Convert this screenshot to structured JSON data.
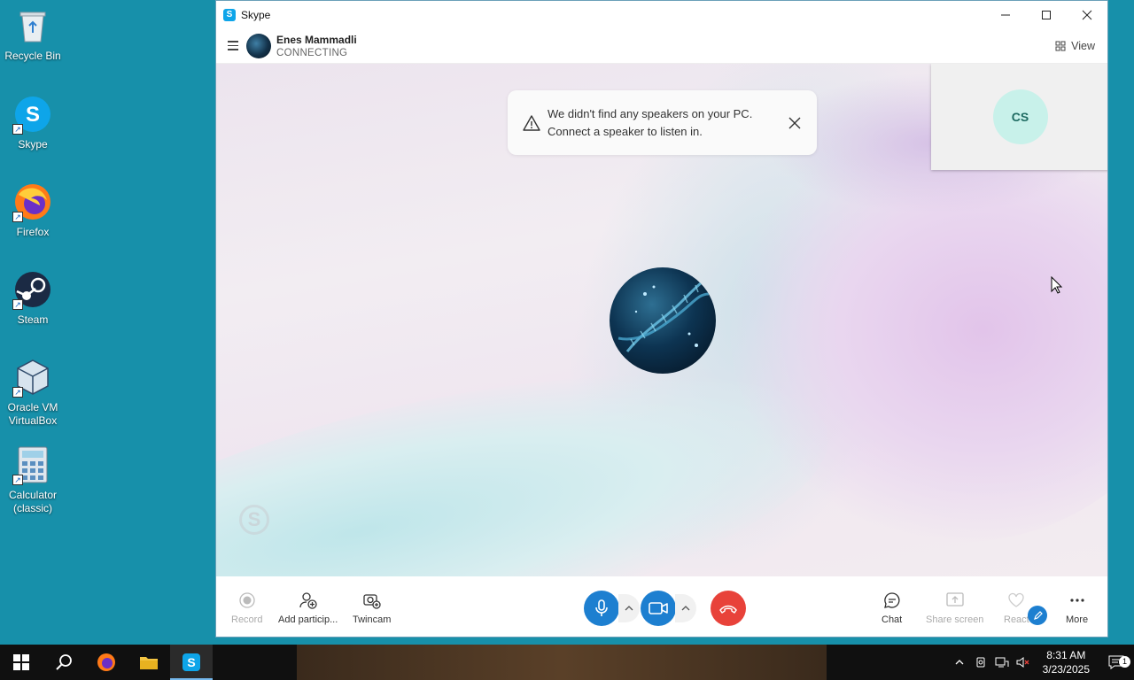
{
  "desktop": {
    "icons": [
      {
        "label": "Recycle Bin"
      },
      {
        "label": "Skype"
      },
      {
        "label": "Firefox"
      },
      {
        "label": "Steam"
      },
      {
        "label": "Oracle VM VirtualBox"
      },
      {
        "label": "Calculator (classic)"
      }
    ]
  },
  "window": {
    "title": "Skype",
    "accent": "#0ea5e9"
  },
  "call": {
    "name": "Enes Mammadli",
    "status": "CONNECTING",
    "view_label": "View",
    "self_initials": "CS",
    "self_avatar_color": "#c8f1ea"
  },
  "toast": {
    "line1": "We didn't find any speakers on your PC.",
    "line2": "Connect a speaker to listen in."
  },
  "toolbar": {
    "record": "Record",
    "add_participants": "Add particip...",
    "twincam": "Twincam",
    "chat": "Chat",
    "share_screen": "Share screen",
    "react": "React",
    "more": "More",
    "mic_color": "#1d7fd0",
    "hangup_color": "#e8423a"
  },
  "taskbar": {
    "time": "8:31 AM",
    "date": "3/23/2025",
    "notification_count": "1"
  }
}
